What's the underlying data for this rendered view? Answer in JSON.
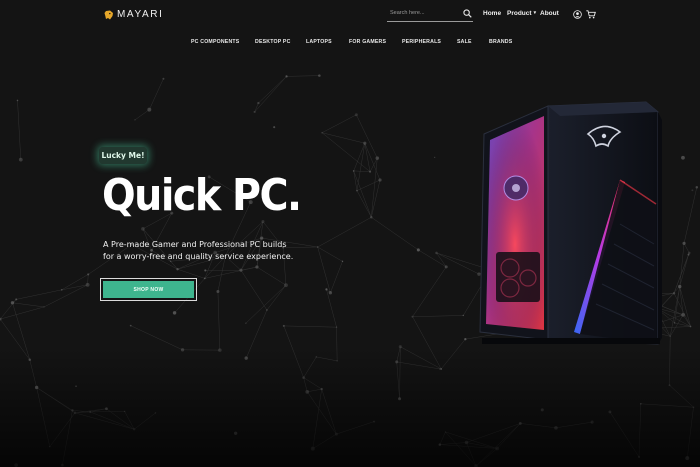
{
  "brand": {
    "name": "MAYARI",
    "logo_icon": "lion-head-icon",
    "logo_color": "#e6a72a"
  },
  "header": {
    "search": {
      "placeholder": "Search here...",
      "icon": "search-icon"
    },
    "nav": {
      "home": "Home",
      "product": "Product",
      "about": "About"
    },
    "user_icon": "user-circle-icon",
    "cart_icon": "cart-icon"
  },
  "categories": [
    "PC COMPONENTS",
    "DESKTOP PC",
    "LAPTOPS",
    "FOR GAMERS",
    "PERIPHERALS",
    "SALE",
    "BRANDS"
  ],
  "hero": {
    "badge": "Lucky Me!",
    "title": "Quick PC.",
    "description_line1": "A Pre-made Gamer and Professional PC builds",
    "description_line2": "for a worry-free and quality service experience.",
    "cta_label": "SHOP NOW"
  },
  "colors": {
    "background": "#141414",
    "accent": "#3eb58e",
    "badge_glow": "#50dcaa"
  }
}
